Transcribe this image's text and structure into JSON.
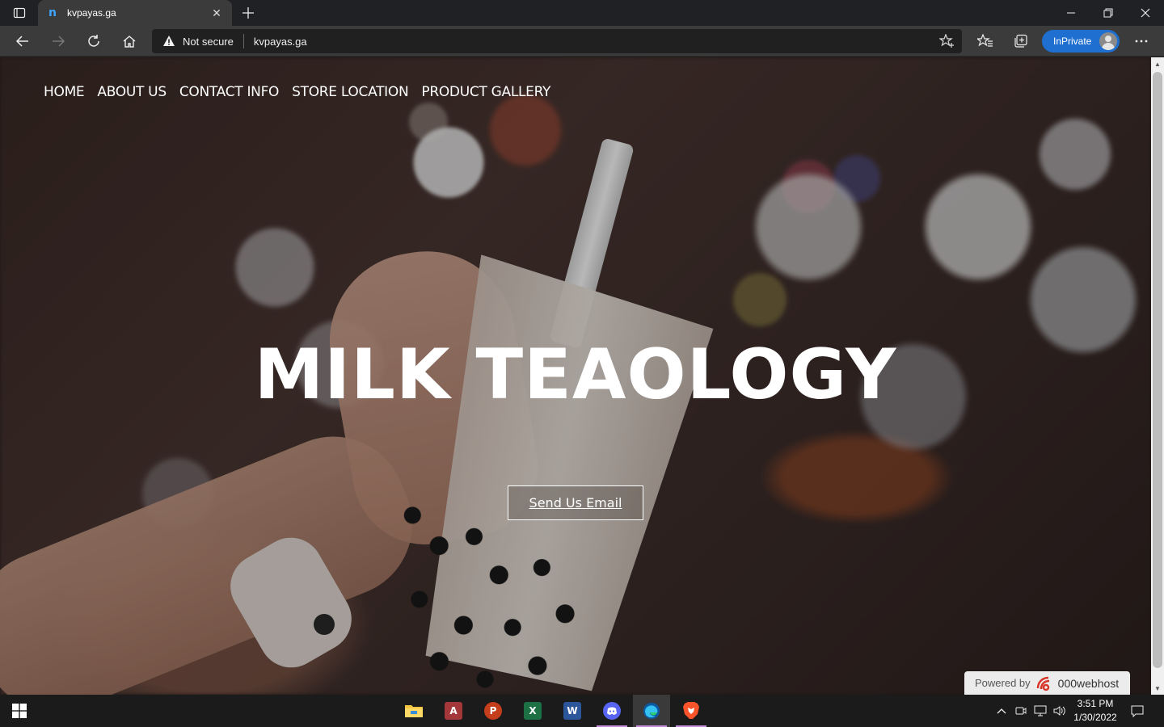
{
  "browser": {
    "tab": {
      "title": "kvpayas.ga",
      "favicon": "n"
    },
    "address": {
      "security_label": "Not secure",
      "url": "kvpayas.ga"
    },
    "inprivate_label": "InPrivate"
  },
  "page": {
    "nav": [
      "HOME",
      "ABOUT US",
      "CONTACT INFO",
      "STORE LOCATION",
      "PRODUCT GALLERY"
    ],
    "hero_title": "MILK TEAOLOGY",
    "cta_label": "Send Us Email",
    "powered": {
      "label": "Powered by",
      "brand": "000webhost"
    }
  },
  "taskbar": {
    "apps": [
      "file-explorer-icon",
      "access-icon",
      "powerpoint-icon",
      "excel-icon",
      "word-icon",
      "discord-icon",
      "edge-icon",
      "brave-icon"
    ],
    "clock": {
      "time": "3:51 PM",
      "date": "1/30/2022"
    }
  },
  "colors": {
    "accent": "#1e6fd0",
    "taskbar_indicator": "#c38bd9",
    "chrome_bg": "#202124"
  }
}
